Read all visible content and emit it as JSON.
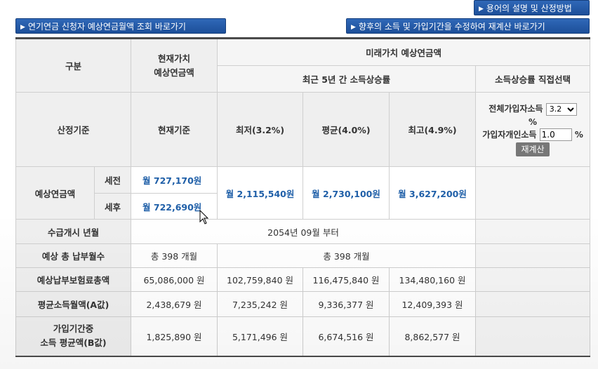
{
  "buttons": {
    "terms": "용어의 설명 및 산정방법",
    "lookup": "연기연금 신청자 예상연금월액 조회 바로가기",
    "recalc_link": "향후의 소득 및 가입기간을 수정하여 재계산 바로가기"
  },
  "header": {
    "category": "구분",
    "current_value_line1": "현재가치",
    "current_value_line2": "예상연금액",
    "future_value": "미래가치 예상연금액",
    "recent_growth": "최근 5년 간 소득상승률",
    "direct_select": "소득상승률 직접선택"
  },
  "basis_row": {
    "label": "산정기준",
    "current": "현재기준",
    "low": "최저(3.2%)",
    "avg": "평균(4.0%)",
    "high": "최고(4.9%)",
    "total_income_label": "전체가입자소득",
    "total_income_value": "3.2",
    "percent": "%",
    "personal_income_label": "가입자개인소득",
    "personal_income_value": "1.0",
    "recalc_button": "재계산"
  },
  "pension_row": {
    "label": "예상연금액",
    "pre_tax_label": "세전",
    "post_tax_label": "세후",
    "pre_tax_current": "월 727,170원",
    "post_tax_current": "월 722,690원",
    "low": "월 2,115,540원",
    "avg": "월 2,730,100원",
    "high": "월 3,627,200원"
  },
  "start_row": {
    "label": "수급개시 년월",
    "value": "2054년 09월 부터"
  },
  "months_row": {
    "label": "예상 총 납부월수",
    "current": "총 398 개월",
    "future": "총 398 개월"
  },
  "premium_row": {
    "label": "예상납부보험료총액",
    "current": "65,086,000 원",
    "low": "102,759,840 원",
    "avg": "116,475,840 원",
    "high": "134,480,160 원"
  },
  "a_value_row": {
    "label": "평균소득월액(A값)",
    "current": "2,438,679 원",
    "low": "7,235,242 원",
    "avg": "9,336,377 원",
    "high": "12,409,393 원"
  },
  "b_value_row": {
    "label_line1": "가입기간중",
    "label_line2": "소득 평균액(B값)",
    "current": "1,825,890 원",
    "low": "5,171,496 원",
    "avg": "6,674,516 원",
    "high": "8,862,577 원"
  }
}
